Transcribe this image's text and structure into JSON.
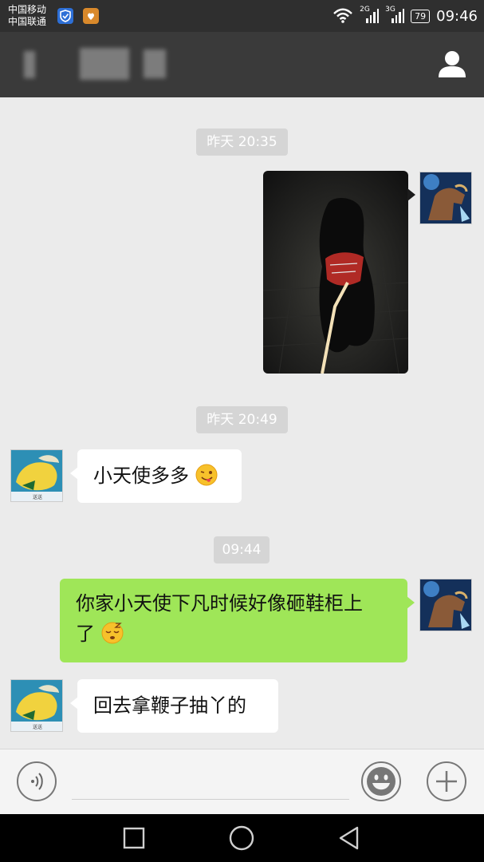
{
  "status_bar": {
    "carrier_1": "中国移动",
    "carrier_2": "中国联通",
    "network_1": "2G",
    "network_2": "3G",
    "battery": "79",
    "time": "09:46",
    "icons": [
      "shield-app-icon",
      "orange-app-icon",
      "wifi-icon",
      "signal-icon",
      "battery-icon"
    ]
  },
  "header": {
    "title_icons": [
      "blurred-contact-name",
      "profile-icon"
    ]
  },
  "chat": {
    "timestamps": [
      "昨天 20:35",
      "昨天 20:49",
      "09:44"
    ],
    "messages": [
      {
        "from": "me",
        "type": "image"
      },
      {
        "from": "friend",
        "type": "text",
        "text": "小天使多多",
        "emoji": "wink-tongue-emoji"
      },
      {
        "from": "me",
        "type": "text",
        "line1": "你家小天使下凡时候好像砸鞋柜上",
        "line2": "了",
        "emoji": "sleepy-emoji"
      },
      {
        "from": "friend",
        "type": "text",
        "text": "回去拿鞭子抽丫的"
      }
    ],
    "friend_avatar_caption": "送送"
  },
  "input_bar": {
    "icons": [
      "voice-icon",
      "emoji-face-icon",
      "plus-icon"
    ]
  },
  "nav_bar": {
    "icons": [
      "recent-apps-icon",
      "home-icon",
      "back-icon"
    ]
  },
  "colors": {
    "outgoing_bubble": "#9fe658",
    "incoming_bubble": "#ffffff",
    "chat_background": "#ebebeb",
    "header": "#3a3a3a"
  }
}
